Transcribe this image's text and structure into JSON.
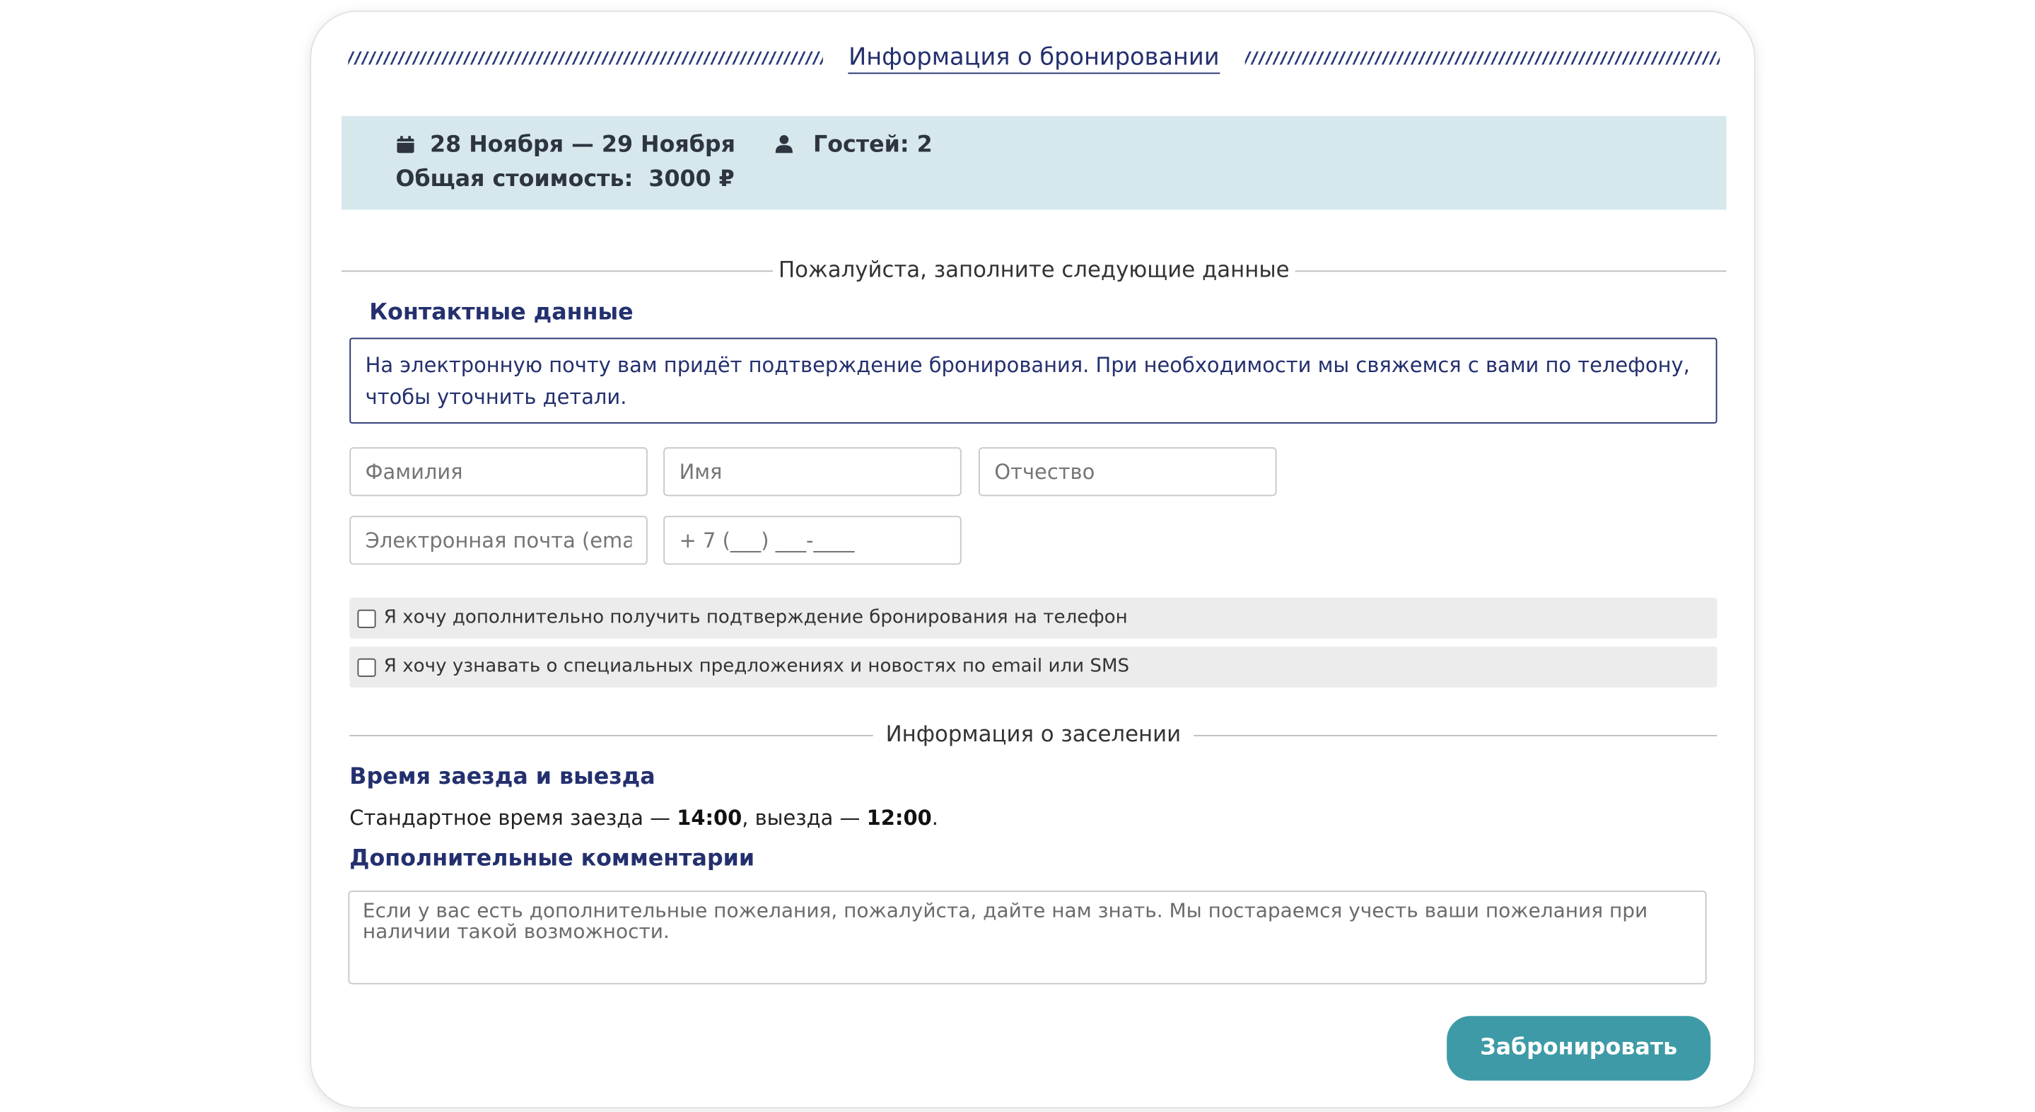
{
  "header": {
    "title": "Информация о бронировании"
  },
  "summary": {
    "dates": "28 Ноября — 29 Ноября",
    "guests": "Гостей: 2",
    "total_label": "Общая стоимость:",
    "total_value": "3000 ₽",
    "calendar_icon": "calendar-icon",
    "user_icon": "user-icon"
  },
  "form": {
    "intro": "Пожалуйста, заполните следующие данные",
    "contacts": {
      "heading": "Контактные данные",
      "notice": "На электронную почту вам придёт подтверждение бронирования. При необходимости мы свяжемся с вами по телефону, чтобы уточнить детали.",
      "fields": {
        "last_name": "Фамилия",
        "first_name": "Имя",
        "patronymic": "Отчество",
        "email": "Электронная почта (email)",
        "phone": "+ 7 (___) ___-____"
      },
      "checkboxes": [
        {
          "label": "Я хочу дополнительно получить подтверждение бронирования на телефон",
          "checked": false
        },
        {
          "label": "Я хочу узнавать о специальных предложениях и новостях по email или SMS",
          "checked": false
        }
      ]
    },
    "checkin": {
      "divider": "Информация о заселении",
      "heading": "Время заезда и выезда",
      "text_before": "Стандартное время заезда — ",
      "checkin_time": "14:00",
      "text_middle": ", выезда — ",
      "checkout_time": "12:00",
      "text_after": "."
    },
    "comments": {
      "heading": "Дополнительные комментарии",
      "placeholder": "Если у вас есть дополнительные пожелания, пожалуйста, дайте нам знать. Мы постараемся учесть ваши пожелания при наличии такой возможности."
    },
    "submit_label": "Забронировать"
  },
  "colors": {
    "accent": "#24306e",
    "summary_bg": "#d6e8ec",
    "button": "#3e9aa6"
  }
}
